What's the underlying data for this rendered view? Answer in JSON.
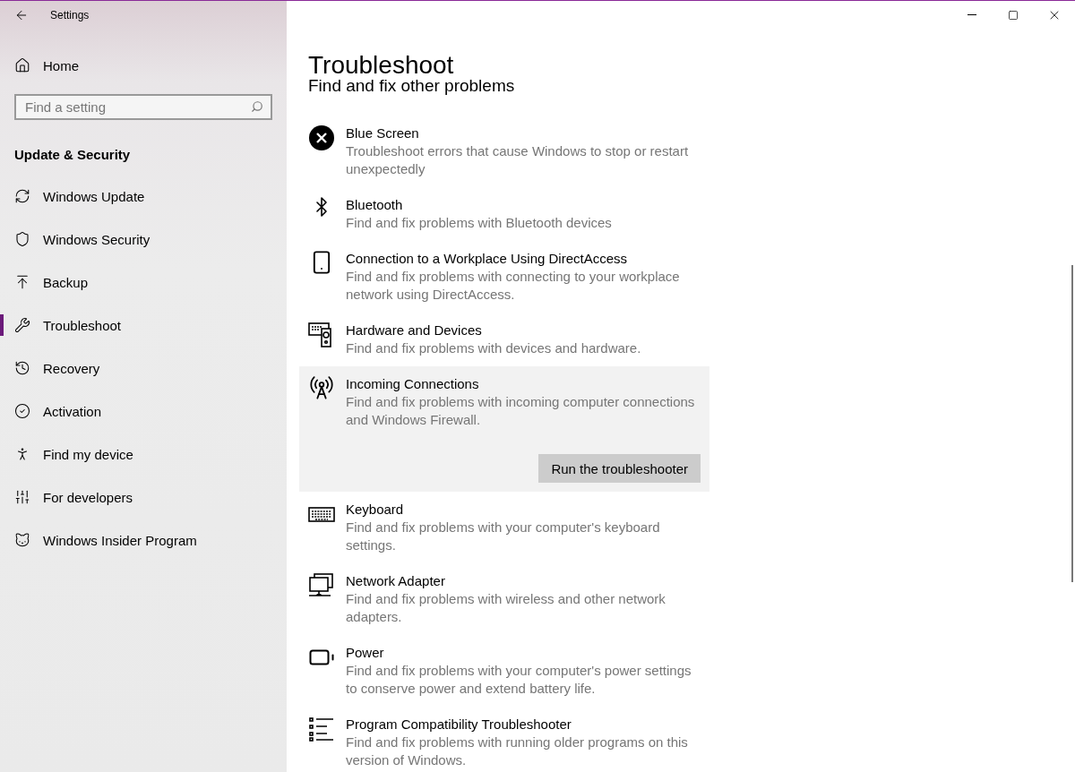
{
  "window": {
    "title": "Settings"
  },
  "sidebar": {
    "home": "Home",
    "search": {
      "placeholder": "Find a setting"
    },
    "section": "Update & Security",
    "items": [
      {
        "label": "Windows Update",
        "selected": false
      },
      {
        "label": "Windows Security",
        "selected": false
      },
      {
        "label": "Backup",
        "selected": false
      },
      {
        "label": "Troubleshoot",
        "selected": true
      },
      {
        "label": "Recovery",
        "selected": false
      },
      {
        "label": "Activation",
        "selected": false
      },
      {
        "label": "Find my device",
        "selected": false
      },
      {
        "label": "For developers",
        "selected": false
      },
      {
        "label": "Windows Insider Program",
        "selected": false
      }
    ]
  },
  "page": {
    "title": "Troubleshoot",
    "subtitle": "Find and fix other problems",
    "troubleshooters": [
      {
        "name": "Blue Screen",
        "description": "Troubleshoot errors that cause Windows to stop or restart unexpectedly",
        "expanded": false
      },
      {
        "name": "Bluetooth",
        "description": "Find and fix problems with Bluetooth devices",
        "expanded": false
      },
      {
        "name": "Connection to a Workplace Using DirectAccess",
        "description": "Find and fix problems with connecting to your workplace network using DirectAccess.",
        "expanded": false
      },
      {
        "name": "Hardware and Devices",
        "description": "Find and fix problems with devices and hardware.",
        "expanded": false
      },
      {
        "name": "Incoming Connections",
        "description": "Find and fix problems with incoming computer connections and Windows Firewall.",
        "expanded": true,
        "button": "Run the troubleshooter"
      },
      {
        "name": "Keyboard",
        "description": "Find and fix problems with your computer's keyboard settings.",
        "expanded": false
      },
      {
        "name": "Network Adapter",
        "description": "Find and fix problems with wireless and other network adapters.",
        "expanded": false
      },
      {
        "name": "Power",
        "description": "Find and fix problems with your computer's power settings to conserve power and extend battery life.",
        "expanded": false
      },
      {
        "name": "Program Compatibility Troubleshooter",
        "description": "Find and fix problems with running older programs on this version of Windows.",
        "expanded": false
      }
    ]
  }
}
